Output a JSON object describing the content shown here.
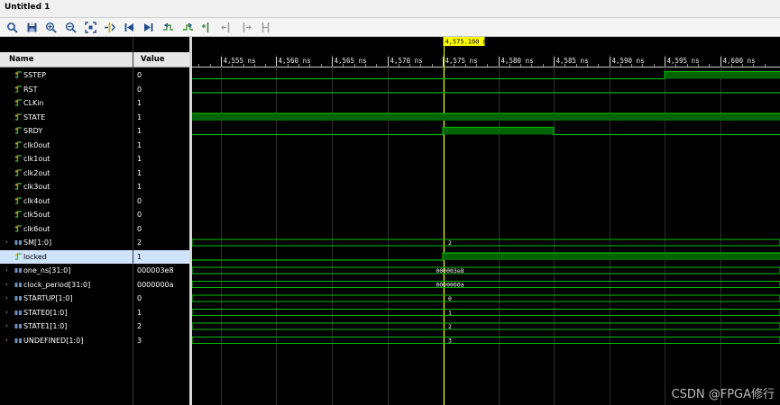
{
  "window": {
    "title": "Untitled 1"
  },
  "toolbar": {
    "buttons": [
      {
        "name": "search-icon"
      },
      {
        "name": "save-icon"
      },
      {
        "name": "zoom-in-icon"
      },
      {
        "name": "zoom-out-icon"
      },
      {
        "name": "zoom-fit-icon"
      },
      {
        "name": "go-to-cursor-icon"
      },
      {
        "name": "go-to-start-icon"
      },
      {
        "name": "go-to-end-icon"
      },
      {
        "name": "previous-transition-icon"
      },
      {
        "name": "next-transition-icon"
      },
      {
        "name": "add-marker-icon"
      },
      {
        "name": "previous-marker-icon"
      },
      {
        "name": "next-marker-icon"
      },
      {
        "name": "swap-cursors-icon"
      }
    ]
  },
  "columns": {
    "name": "Name",
    "value": "Value"
  },
  "cursor": {
    "label": "4,575.100 ns",
    "time_ns": 4575.1,
    "color": "#ffff00"
  },
  "time_axis": {
    "start_ns": 4552.4,
    "end_ns": 4605.4,
    "ticks": [
      "4,555 ns",
      "4,560 ns",
      "4,565 ns",
      "4,570 ns",
      "4,575 ns",
      "4,580 ns",
      "4,585 ns",
      "4,590 ns",
      "4,595 ns",
      "4,600 ns"
    ]
  },
  "colors": {
    "waveform": "#00b000",
    "bus_line": "#00c000",
    "wave_fill": "#006400",
    "grid": "#2e2e2e",
    "selection": "#cfe3fb"
  },
  "signals": [
    {
      "name": "SSTEP",
      "value": "0",
      "kind": "bit"
    },
    {
      "name": "RST",
      "value": "0",
      "kind": "bit"
    },
    {
      "name": "CLKin",
      "value": "1",
      "kind": "bit"
    },
    {
      "name": "STATE",
      "value": "1",
      "kind": "bit"
    },
    {
      "name": "SRDY",
      "value": "1",
      "kind": "bit"
    },
    {
      "name": "clk0out",
      "value": "1",
      "kind": "bit"
    },
    {
      "name": "clk1out",
      "value": "1",
      "kind": "bit"
    },
    {
      "name": "clk2out",
      "value": "1",
      "kind": "bit"
    },
    {
      "name": "clk3out",
      "value": "1",
      "kind": "bit"
    },
    {
      "name": "clk4out",
      "value": "0",
      "kind": "bit"
    },
    {
      "name": "clk5out",
      "value": "0",
      "kind": "bit"
    },
    {
      "name": "clk6out",
      "value": "0",
      "kind": "bit"
    },
    {
      "name": "SM[1:0]",
      "value": "2",
      "kind": "bus",
      "bus_label": "2"
    },
    {
      "name": "locked",
      "value": "1",
      "kind": "bit",
      "selected": true
    },
    {
      "name": "one_ns[31:0]",
      "value": "000003e8",
      "kind": "bus",
      "bus_label": "000003e8"
    },
    {
      "name": "clock_period[31:0]",
      "value": "0000000a",
      "kind": "bus",
      "bus_label": "0000000a"
    },
    {
      "name": "STARTUP[1:0]",
      "value": "0",
      "kind": "bus",
      "bus_label": "0"
    },
    {
      "name": "STATE0[1:0]",
      "value": "1",
      "kind": "bus",
      "bus_label": "1"
    },
    {
      "name": "STATE1[1:0]",
      "value": "2",
      "kind": "bus",
      "bus_label": "2"
    },
    {
      "name": "UNDEFINED[1:0]",
      "value": "3",
      "kind": "bus",
      "bus_label": "3"
    }
  ],
  "watermark": "CSDN @FPGA修行"
}
